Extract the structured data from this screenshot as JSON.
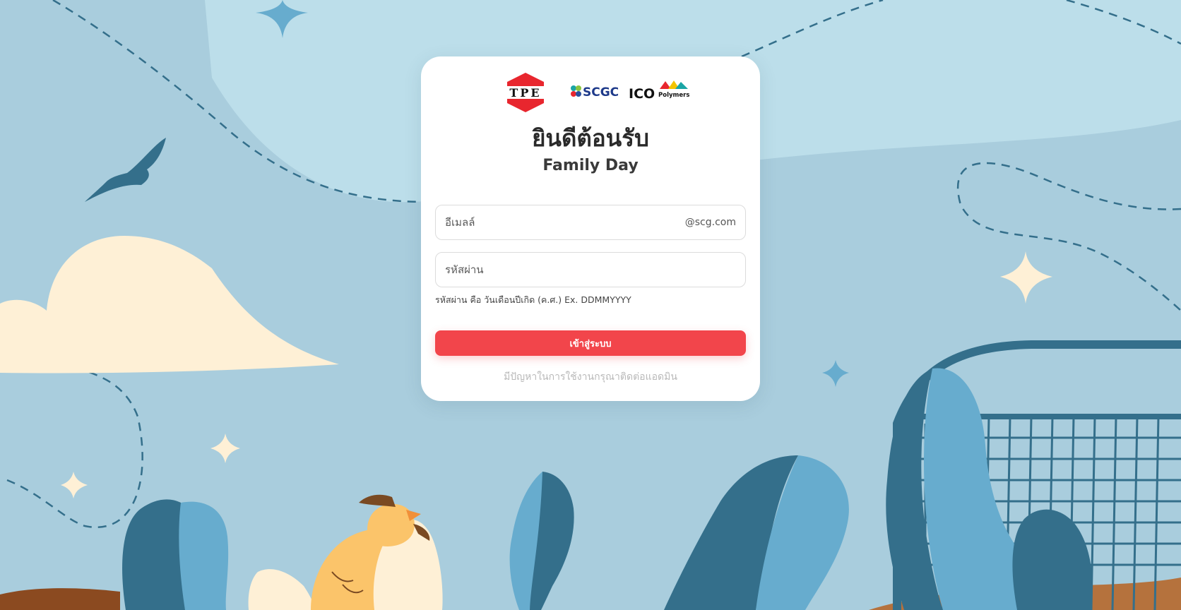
{
  "app": {
    "title": "ยินดีต้อนรับ",
    "subtitle": "Family Day"
  },
  "logos": {
    "tpe_text": "TPE",
    "scgc_text": "SCGC",
    "ico_text": "ICO",
    "ico_subtext": "Polymers"
  },
  "form": {
    "email_placeholder": "อีเมลล์",
    "email_value": "",
    "email_suffix": "@scg.com",
    "password_placeholder": "รหัสผ่าน",
    "password_value": "",
    "password_hint": "รหัสผ่าน คือ วันเดือนปีเกิด (ค.ศ.) Ex. DDMMYYYY",
    "login_label": "เข้าสู่ระบบ",
    "help_text": "มีปัญหาในการใช้งานกรุณาติดต่อแอดมิน"
  },
  "colors": {
    "accent": "#f2454b",
    "background": "#a9cddd",
    "sky_light": "#bcdeea",
    "dark_teal": "#346f8b",
    "light_teal": "#67acce",
    "cream": "#fef0d6",
    "ground": "#b5723d"
  },
  "illustration": {
    "elements": [
      "bird-icon",
      "cloud-icon",
      "sparkle-icon",
      "hen-icon",
      "plant-icon",
      "soccer-goal-icon"
    ]
  }
}
